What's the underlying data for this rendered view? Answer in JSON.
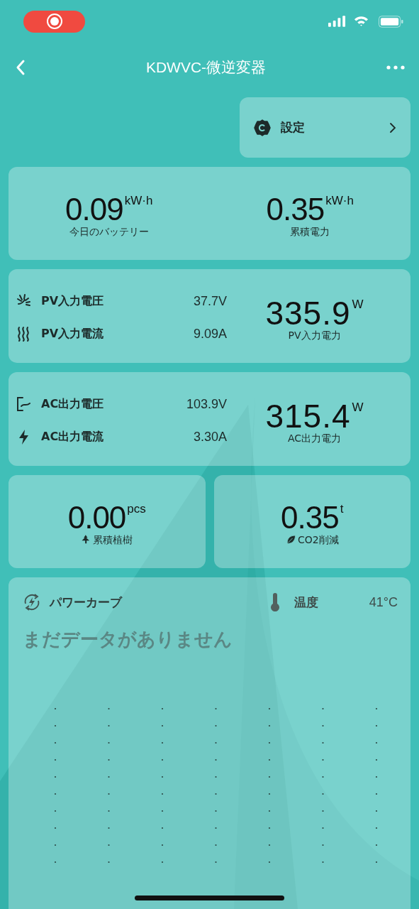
{
  "nav": {
    "title": "KDWVC-微逆変器"
  },
  "settings": {
    "label": "設定"
  },
  "energy": [
    {
      "value": "0.09",
      "unit": "kW·h",
      "label": "今日のバッテリー"
    },
    {
      "value": "0.35",
      "unit": "kW·h",
      "label": "累積電力"
    }
  ],
  "groups": [
    {
      "rows": [
        {
          "kind": "sun",
          "label": "PV入力電圧",
          "value": "37.7V"
        },
        {
          "kind": "heat",
          "label": "PV入力電流",
          "value": "9.09A"
        }
      ],
      "total": {
        "value": "335.9",
        "unit": "W",
        "label": "PV入力電力"
      }
    },
    {
      "rows": [
        {
          "kind": "plug",
          "label": "AC出力電圧",
          "value": "103.9V"
        },
        {
          "kind": "bolt",
          "label": "AC出力電流",
          "value": "3.30A"
        }
      ],
      "total": {
        "value": "315.4",
        "unit": "W",
        "label": "AC出力電力"
      }
    }
  ],
  "impact": [
    {
      "kind": "tree",
      "value": "0.00",
      "unit": "pcs",
      "label": "累積植樹"
    },
    {
      "kind": "leaf",
      "value": "0.35",
      "unit": "t",
      "label": "CO2削減"
    }
  ],
  "power_curve": {
    "title": "パワーカーブ",
    "temperature_label": "温度",
    "temperature": "41°C",
    "empty_message": "まだデータがありません"
  }
}
